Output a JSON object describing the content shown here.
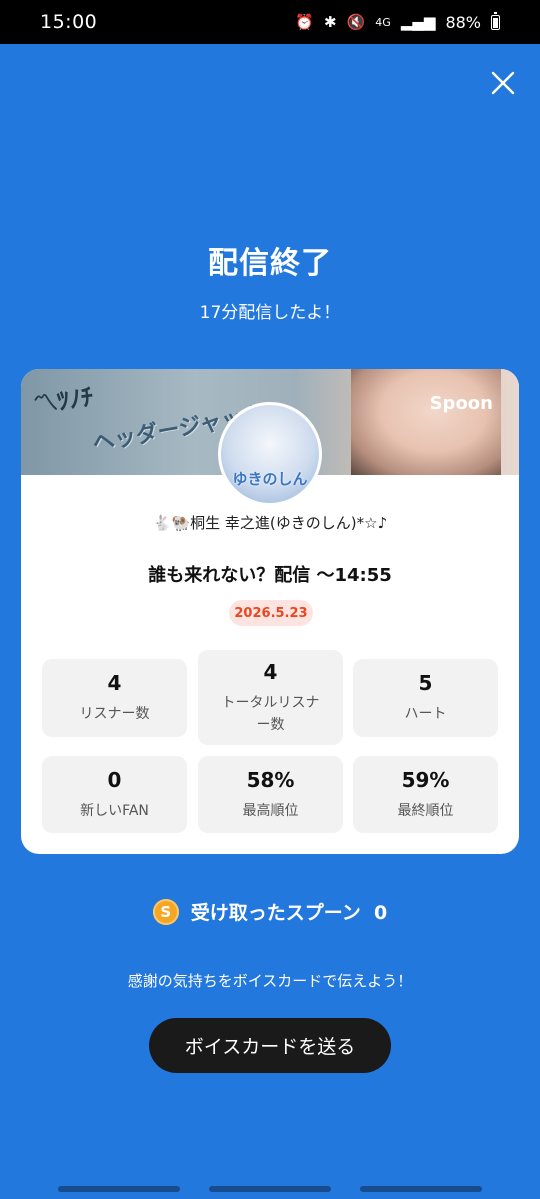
{
  "status_bar": {
    "time": "15:00",
    "network": "4G",
    "battery": "88%"
  },
  "header": {
    "title": "配信終了",
    "subtitle": "17分配信したよ！"
  },
  "card": {
    "banner_text": "ヘッダージャック！",
    "banner_logo": "Spoon",
    "avatar_label": "ゆきのしん",
    "username": "🐇🐏桐生 幸之進(ゆきのしん)*☆♪",
    "stream_title": "誰も来れない？配信 〜14:55",
    "date": "2026.5.23",
    "stats": [
      {
        "value": "4",
        "label": "リスナー数"
      },
      {
        "value": "4",
        "label": "トータルリスナー数"
      },
      {
        "value": "5",
        "label": "ハート"
      },
      {
        "value": "0",
        "label": "新しいFAN"
      },
      {
        "value": "58%",
        "label": "最高順位"
      },
      {
        "value": "59%",
        "label": "最終順位"
      }
    ]
  },
  "spoon": {
    "coin_label": "S",
    "label": "受け取ったスプーン",
    "count": "0"
  },
  "thanks_text": "感謝の気持ちをボイスカードで伝えよう！",
  "send_button_label": "ボイスカードを送る",
  "colors": {
    "background": "#2378DE",
    "date_badge_text": "#E8471F",
    "button": "#1A1A1A"
  }
}
